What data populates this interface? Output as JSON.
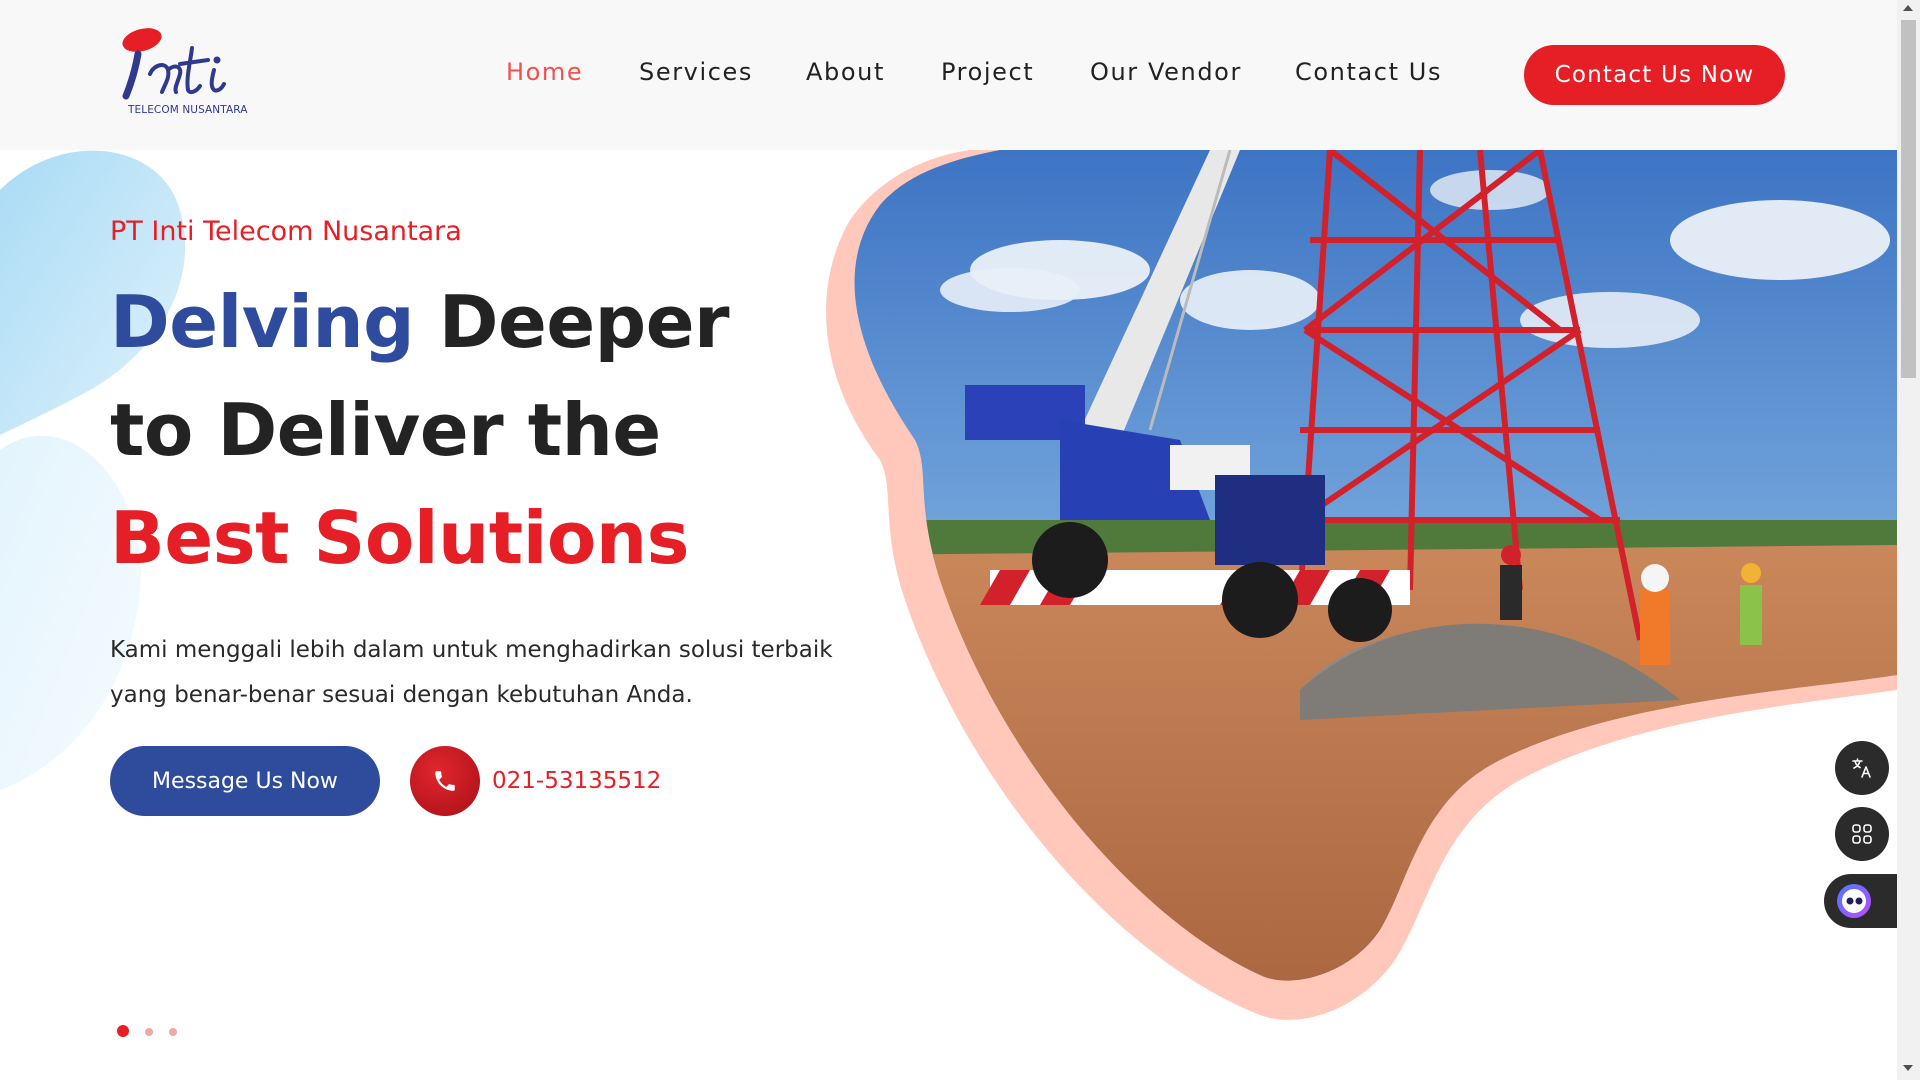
{
  "brand": {
    "logo_text": "Inti",
    "logo_subtitle": "TELECOM NUSANTARA"
  },
  "nav": {
    "items": [
      {
        "label": "Home",
        "active": true
      },
      {
        "label": "Services",
        "active": false
      },
      {
        "label": "About",
        "active": false
      },
      {
        "label": "Project",
        "active": false
      },
      {
        "label": "Our Vendor",
        "active": false
      },
      {
        "label": "Contact Us",
        "active": false
      }
    ],
    "cta_label": "Contact Us Now"
  },
  "hero": {
    "eyebrow": "PT Inti Telecom Nusantara",
    "headline_word_blue": "Delving",
    "headline_rest_1": " Deeper",
    "headline_line_2": "to Deliver the",
    "headline_line_3": "Best Solutions",
    "description": "Kami menggali lebih dalam untuk menghadirkan solusi terbaik yang benar-benar sesuai dengan kebutuhan Anda.",
    "primary_button": "Message Us Now",
    "phone": "021-53135512",
    "image_subject": "crane-and-telecom-tower-construction-site"
  },
  "slider": {
    "count": 3,
    "active_index": 0
  },
  "widgets": {
    "icons": [
      "translate-icon",
      "apps-icon",
      "chat-bot-icon"
    ]
  },
  "colors": {
    "brand_red": "#e61f26",
    "brand_blue": "#2e4b9e",
    "nav_active": "#f0524f",
    "blob_pink": "#ffc8bb",
    "deco_blue": "#bfe6f8"
  }
}
